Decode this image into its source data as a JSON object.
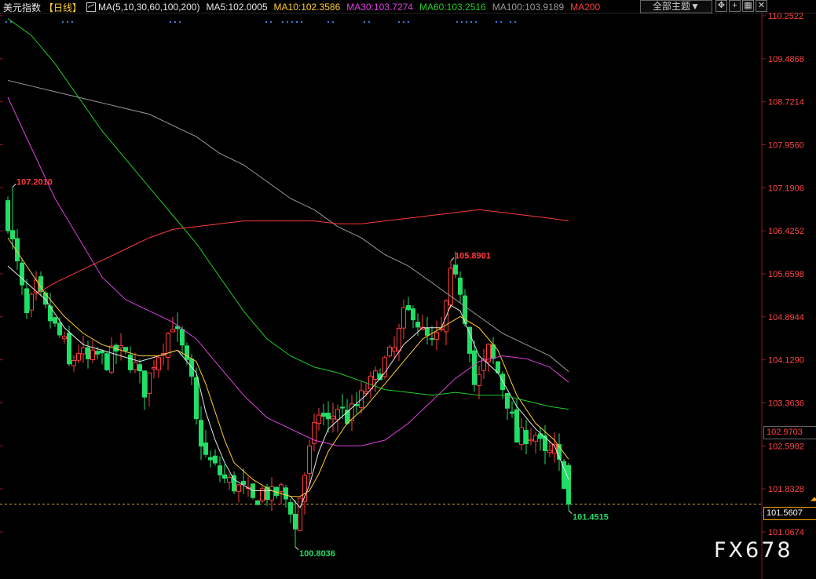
{
  "header": {
    "title": "美元指数",
    "period": "【日线】",
    "ma_items": [
      {
        "text": "MA(5,10,30,60,100,200)",
        "color": "#e6e6e6"
      },
      {
        "text": "MA5:102.0005",
        "color": "#e6e6e6"
      },
      {
        "text": "MA10:102.3586",
        "color": "#ffcc33"
      },
      {
        "text": "MA30:103.7274",
        "color": "#e040e0"
      },
      {
        "text": "MA60:103.2516",
        "color": "#22cc22"
      },
      {
        "text": "MA100:103.9189",
        "color": "#9a9a9a"
      },
      {
        "text": "MA200",
        "color": "#ff3b3b"
      }
    ],
    "theme_button": "全部主题▼",
    "tool_icons": [
      "move-icon",
      "zoom-in-icon",
      "grid-icon",
      "close-icon"
    ]
  },
  "watermark": "FX678",
  "chart_data": {
    "type": "candlestick",
    "y_axis": {
      "ticks": [
        "110.2522",
        "109.4868",
        "108.7214",
        "107.9560",
        "107.1906",
        "106.4252",
        "105.6598",
        "104.8944",
        "104.1290",
        "103.3636",
        "102.5982",
        "101.8328",
        "101.0674"
      ],
      "range": [
        100.8,
        110.25
      ]
    },
    "last_price": "101.5607",
    "highlight_price": "102.9703",
    "annotations": [
      {
        "text": "107.2010",
        "value": 107.201,
        "index": 1,
        "color": "#ff3b3b"
      },
      {
        "text": "105.8901",
        "value": 105.8901,
        "index": 94,
        "color": "#ff3b3b"
      },
      {
        "text": "100.8036",
        "value": 100.8036,
        "index": 61,
        "color": "#22dd66"
      },
      {
        "text": "101.4515",
        "value": 101.4515,
        "index": 119,
        "color": "#22dd66"
      }
    ],
    "colors": {
      "up": "#ff3b3b",
      "down": "#22dd66",
      "ma5": "#e6e6e6",
      "ma10": "#ffcc33",
      "ma30": "#e040e0",
      "ma60": "#22cc22",
      "ma100": "#9a9a9a",
      "ma200": "#ff3b3b"
    },
    "close_path": [
      [
        0,
        106.6
      ],
      [
        2,
        105.8
      ],
      [
        4,
        104.9
      ],
      [
        6,
        105.4
      ],
      [
        8,
        105.0
      ],
      [
        10,
        104.7
      ],
      [
        12,
        104.4
      ],
      [
        13,
        104.0
      ],
      [
        15,
        104.3
      ],
      [
        17,
        104.1
      ],
      [
        19,
        104.2
      ],
      [
        21,
        104.1
      ],
      [
        23,
        104.3
      ],
      [
        25,
        104.2
      ],
      [
        27,
        104.0
      ],
      [
        29,
        103.6
      ],
      [
        31,
        104.1
      ],
      [
        33,
        104.4
      ],
      [
        35,
        104.8
      ],
      [
        37,
        104.3
      ],
      [
        38,
        104.0
      ],
      [
        39,
        103.7
      ],
      [
        40,
        103.0
      ],
      [
        42,
        102.4
      ],
      [
        44,
        102.2
      ],
      [
        46,
        102.0
      ],
      [
        48,
        101.9
      ],
      [
        50,
        101.8
      ],
      [
        52,
        101.6
      ],
      [
        54,
        101.8
      ],
      [
        56,
        101.7
      ],
      [
        58,
        101.8
      ],
      [
        60,
        101.5
      ],
      [
        61,
        101.1
      ],
      [
        62,
        101.7
      ],
      [
        64,
        102.5
      ],
      [
        66,
        103.2
      ],
      [
        68,
        103.0
      ],
      [
        70,
        103.3
      ],
      [
        72,
        103.1
      ],
      [
        74,
        103.3
      ],
      [
        76,
        103.6
      ],
      [
        78,
        103.8
      ],
      [
        80,
        104.1
      ],
      [
        82,
        104.3
      ],
      [
        84,
        104.9
      ],
      [
        86,
        105.0
      ],
      [
        88,
        104.6
      ],
      [
        90,
        104.4
      ],
      [
        92,
        104.6
      ],
      [
        94,
        105.6
      ],
      [
        96,
        105.4
      ],
      [
        98,
        104.4
      ],
      [
        99,
        103.7
      ],
      [
        100,
        103.8
      ],
      [
        102,
        104.3
      ],
      [
        104,
        103.9
      ],
      [
        106,
        103.4
      ],
      [
        108,
        102.7
      ],
      [
        110,
        102.8
      ],
      [
        112,
        102.8
      ],
      [
        114,
        102.4
      ],
      [
        116,
        102.5
      ],
      [
        118,
        102.0
      ],
      [
        119,
        101.6
      ]
    ],
    "ma_series": [
      {
        "name": "MA5",
        "values": [
          [
            0,
            105.8
          ],
          [
            4,
            105.5
          ],
          [
            8,
            105.2
          ],
          [
            12,
            104.7
          ],
          [
            16,
            104.4
          ],
          [
            20,
            104.3
          ],
          [
            24,
            104.2
          ],
          [
            28,
            104.1
          ],
          [
            32,
            104.2
          ],
          [
            36,
            104.3
          ],
          [
            40,
            103.9
          ],
          [
            42,
            103.2
          ],
          [
            44,
            102.7
          ],
          [
            46,
            102.3
          ],
          [
            48,
            102.0
          ],
          [
            52,
            101.8
          ],
          [
            56,
            101.8
          ],
          [
            60,
            101.7
          ],
          [
            62,
            101.5
          ],
          [
            64,
            101.9
          ],
          [
            66,
            102.5
          ],
          [
            68,
            102.9
          ],
          [
            72,
            103.2
          ],
          [
            76,
            103.5
          ],
          [
            80,
            103.9
          ],
          [
            84,
            104.4
          ],
          [
            88,
            104.7
          ],
          [
            92,
            104.7
          ],
          [
            94,
            105.1
          ],
          [
            96,
            105.0
          ],
          [
            98,
            104.6
          ],
          [
            100,
            104.2
          ],
          [
            104,
            103.9
          ],
          [
            108,
            103.3
          ],
          [
            112,
            102.9
          ],
          [
            116,
            102.6
          ],
          [
            119,
            102.0
          ]
        ]
      },
      {
        "name": "MA10",
        "values": [
          [
            0,
            106.3
          ],
          [
            4,
            105.8
          ],
          [
            8,
            105.3
          ],
          [
            12,
            104.9
          ],
          [
            16,
            104.6
          ],
          [
            20,
            104.4
          ],
          [
            24,
            104.3
          ],
          [
            28,
            104.2
          ],
          [
            32,
            104.2
          ],
          [
            36,
            104.3
          ],
          [
            40,
            104.1
          ],
          [
            42,
            103.7
          ],
          [
            44,
            103.2
          ],
          [
            46,
            102.7
          ],
          [
            48,
            102.3
          ],
          [
            52,
            102.0
          ],
          [
            56,
            101.8
          ],
          [
            60,
            101.7
          ],
          [
            62,
            101.7
          ],
          [
            64,
            101.8
          ],
          [
            66,
            102.1
          ],
          [
            68,
            102.5
          ],
          [
            72,
            103.0
          ],
          [
            76,
            103.3
          ],
          [
            80,
            103.7
          ],
          [
            84,
            104.1
          ],
          [
            88,
            104.5
          ],
          [
            92,
            104.7
          ],
          [
            96,
            104.9
          ],
          [
            98,
            104.8
          ],
          [
            100,
            104.7
          ],
          [
            104,
            104.3
          ],
          [
            106,
            103.9
          ],
          [
            108,
            103.5
          ],
          [
            112,
            103.0
          ],
          [
            116,
            102.7
          ],
          [
            119,
            102.36
          ]
        ]
      },
      {
        "name": "MA30",
        "values": [
          [
            0,
            108.8
          ],
          [
            5,
            107.9
          ],
          [
            10,
            107.0
          ],
          [
            15,
            106.3
          ],
          [
            20,
            105.6
          ],
          [
            25,
            105.2
          ],
          [
            30,
            105.0
          ],
          [
            35,
            104.8
          ],
          [
            40,
            104.5
          ],
          [
            45,
            104.0
          ],
          [
            50,
            103.5
          ],
          [
            55,
            103.1
          ],
          [
            60,
            102.9
          ],
          [
            65,
            102.7
          ],
          [
            70,
            102.6
          ],
          [
            75,
            102.6
          ],
          [
            80,
            102.7
          ],
          [
            85,
            103.0
          ],
          [
            90,
            103.4
          ],
          [
            95,
            103.8
          ],
          [
            100,
            104.1
          ],
          [
            105,
            104.2
          ],
          [
            110,
            104.15
          ],
          [
            115,
            104.0
          ],
          [
            119,
            103.73
          ]
        ]
      },
      {
        "name": "MA60",
        "values": [
          [
            0,
            110.2
          ],
          [
            5,
            109.9
          ],
          [
            10,
            109.4
          ],
          [
            15,
            108.8
          ],
          [
            20,
            108.2
          ],
          [
            25,
            107.7
          ],
          [
            30,
            107.2
          ],
          [
            35,
            106.7
          ],
          [
            40,
            106.2
          ],
          [
            45,
            105.6
          ],
          [
            50,
            105.0
          ],
          [
            55,
            104.5
          ],
          [
            60,
            104.2
          ],
          [
            65,
            104.0
          ],
          [
            70,
            103.9
          ],
          [
            75,
            103.75
          ],
          [
            80,
            103.6
          ],
          [
            85,
            103.55
          ],
          [
            90,
            103.5
          ],
          [
            95,
            103.55
          ],
          [
            100,
            103.5
          ],
          [
            105,
            103.5
          ],
          [
            110,
            103.4
          ],
          [
            115,
            103.3
          ],
          [
            119,
            103.25
          ]
        ]
      },
      {
        "name": "MA100",
        "values": [
          [
            0,
            109.1
          ],
          [
            5,
            109.0
          ],
          [
            10,
            108.9
          ],
          [
            15,
            108.8
          ],
          [
            20,
            108.7
          ],
          [
            25,
            108.6
          ],
          [
            30,
            108.5
          ],
          [
            35,
            108.3
          ],
          [
            40,
            108.1
          ],
          [
            45,
            107.8
          ],
          [
            50,
            107.6
          ],
          [
            55,
            107.3
          ],
          [
            60,
            107.0
          ],
          [
            65,
            106.8
          ],
          [
            70,
            106.5
          ],
          [
            75,
            106.3
          ],
          [
            80,
            106.0
          ],
          [
            85,
            105.8
          ],
          [
            90,
            105.5
          ],
          [
            95,
            105.2
          ],
          [
            100,
            104.9
          ],
          [
            105,
            104.6
          ],
          [
            110,
            104.4
          ],
          [
            115,
            104.2
          ],
          [
            119,
            103.92
          ]
        ]
      },
      {
        "name": "MA200",
        "values": [
          [
            6,
            105.3
          ],
          [
            10,
            105.5
          ],
          [
            15,
            105.7
          ],
          [
            20,
            105.9
          ],
          [
            25,
            106.1
          ],
          [
            30,
            106.3
          ],
          [
            35,
            106.45
          ],
          [
            40,
            106.5
          ],
          [
            45,
            106.55
          ],
          [
            50,
            106.6
          ],
          [
            55,
            106.6
          ],
          [
            60,
            106.6
          ],
          [
            65,
            106.6
          ],
          [
            70,
            106.55
          ],
          [
            75,
            106.55
          ],
          [
            80,
            106.6
          ],
          [
            85,
            106.65
          ],
          [
            90,
            106.7
          ],
          [
            95,
            106.75
          ],
          [
            100,
            106.8
          ],
          [
            105,
            106.75
          ],
          [
            110,
            106.7
          ],
          [
            115,
            106.65
          ],
          [
            119,
            106.6
          ]
        ]
      }
    ]
  }
}
